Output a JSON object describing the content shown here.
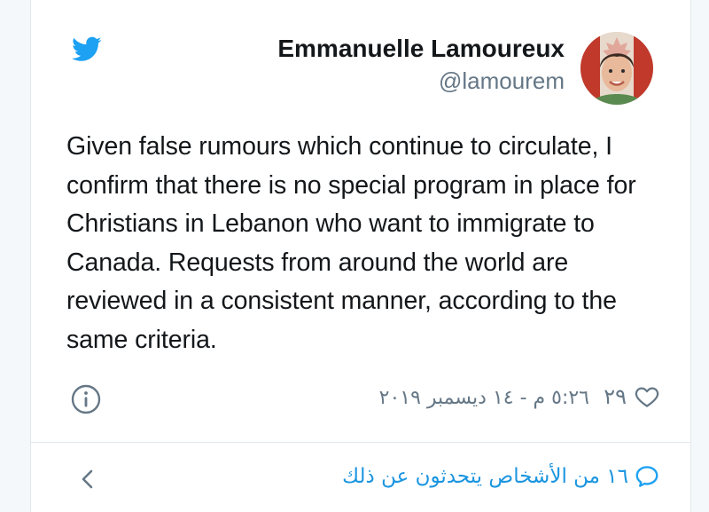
{
  "colors": {
    "accent": "#1da1f2",
    "link": "#1b95e0",
    "muted": "#657786",
    "text": "#14171a",
    "border": "#e1e8ed"
  },
  "icons": {
    "logo": "twitter-bird-icon",
    "info": "info-circle-icon",
    "like": "heart-outline-icon",
    "reply": "speech-bubble-icon",
    "back": "chevron-left-icon"
  },
  "author": {
    "name": "Emmanuelle Lamoureux",
    "handle": "@lamourem"
  },
  "tweet": {
    "text": "Given false rumours which continue to circulate, I confirm that there is no special program in place for Christians in Lebanon who want to immigrate to Canada. Requests from around the world are reviewed in a consistent manner, according to the same criteria."
  },
  "meta": {
    "like_count": "٢٩",
    "timestamp": "٥:٢٦ م - ١٤ ديسمبر ٢٠١٩"
  },
  "footer": {
    "people_talking": "١٦ من الأشخاص يتحدثون عن ذلك"
  }
}
